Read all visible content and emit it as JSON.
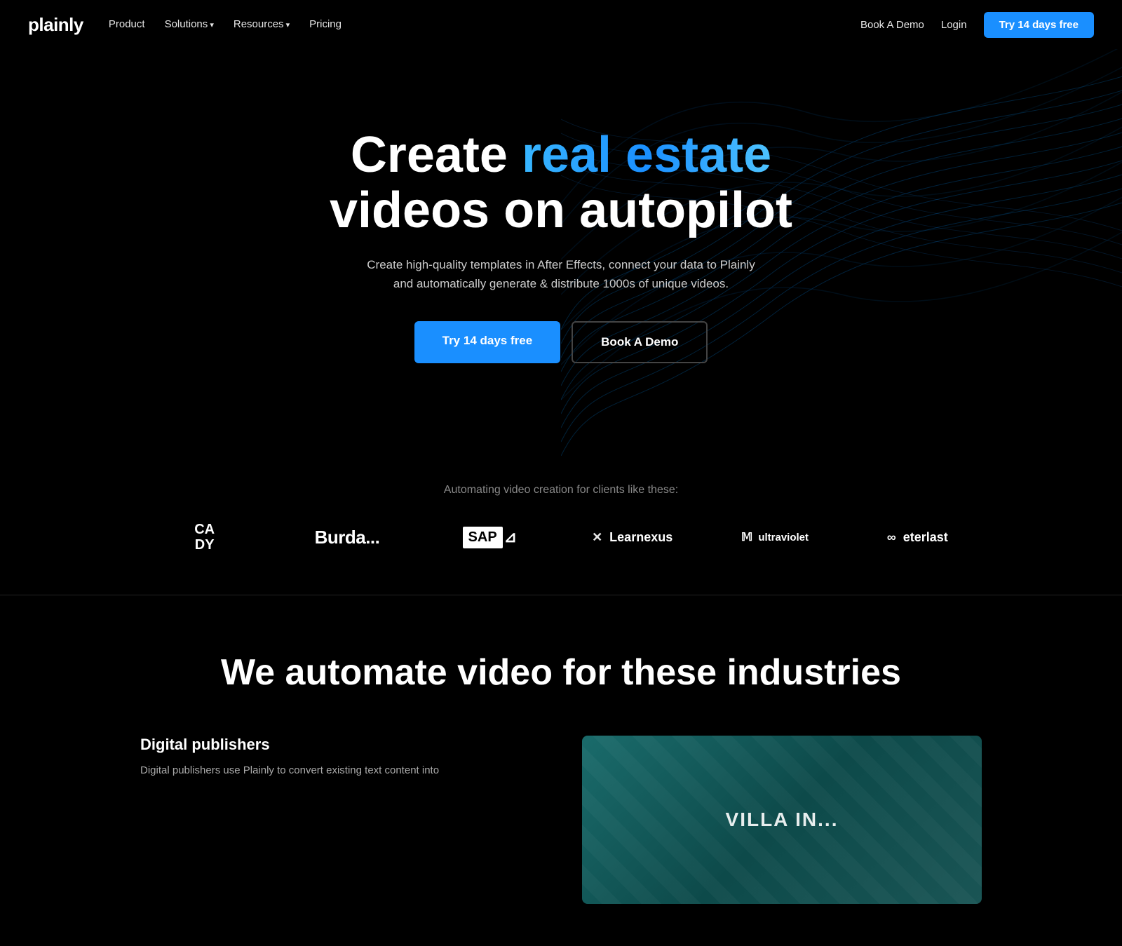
{
  "brand": {
    "logo": "plainly"
  },
  "nav": {
    "links": [
      {
        "label": "Product",
        "hasArrow": false
      },
      {
        "label": "Solutions",
        "hasArrow": true
      },
      {
        "label": "Resources",
        "hasArrow": true
      },
      {
        "label": "Pricing",
        "hasArrow": false
      }
    ],
    "book_demo": "Book A Demo",
    "login": "Login",
    "cta": "Try 14 days free"
  },
  "hero": {
    "title_start": "Create ",
    "title_gradient": "real estate",
    "title_end": " videos on autopilot",
    "subtitle": "Create high-quality templates in After Effects, connect your data to Plainly and automatically generate & distribute 1000s of unique videos.",
    "cta_primary": "Try 14 days free",
    "cta_secondary": "Book A Demo"
  },
  "clients": {
    "label": "Automating video creation for clients like these:",
    "logos": [
      {
        "id": "cady",
        "text": "CA\nDY"
      },
      {
        "id": "burda",
        "text": "Burda..."
      },
      {
        "id": "sap",
        "text": "SAP"
      },
      {
        "id": "learnexus",
        "text": "Learnexus"
      },
      {
        "id": "ultraviolet",
        "text": "ultraviolet"
      },
      {
        "id": "eterlast",
        "text": "eterlast"
      }
    ]
  },
  "industries": {
    "title": "We automate video for these industries",
    "items": [
      {
        "name": "Digital publishers",
        "description": "Digital publishers use Plainly to convert existing text content into"
      }
    ],
    "video_label": "VILLA IN..."
  }
}
